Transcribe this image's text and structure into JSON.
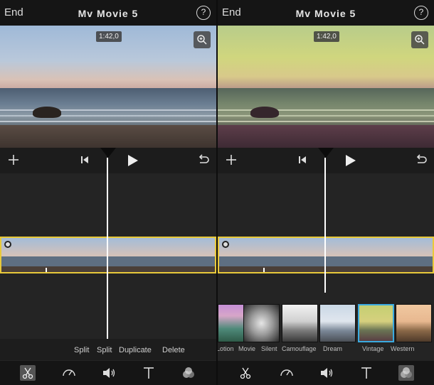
{
  "panels": [
    {
      "end_label": "End",
      "title": "Mv Movie 5",
      "help_label": "?",
      "timecode": "1:42,0",
      "actions": [
        "Split",
        "Split",
        "Duplicate",
        "Delete"
      ],
      "tools": [
        "scissors-icon",
        "speedometer-icon",
        "volume-icon",
        "text-icon",
        "filters-icon"
      ],
      "active_tool": "scissors-icon"
    },
    {
      "end_label": "End",
      "title": "Mv Movie 5",
      "help_label": "?",
      "timecode": "1:42,0",
      "filters": [
        "Lotion",
        "Movie",
        "Silent",
        "Camouflage",
        "Dream",
        "Vintage",
        "Western"
      ],
      "selected_filter": "Dream",
      "tools": [
        "scissors-icon",
        "speedometer-icon",
        "volume-icon",
        "text-icon",
        "filters-icon"
      ],
      "active_tool": "filters-icon"
    }
  ],
  "colors": {
    "selection": "#e8c93a",
    "filter_selection": "#3aaae0",
    "vintage_tint": "#b9c36a"
  }
}
